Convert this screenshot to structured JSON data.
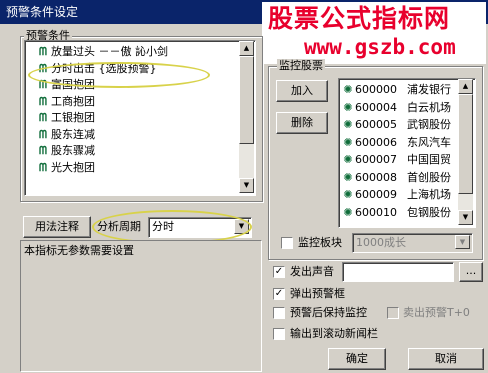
{
  "window": {
    "title": "预警条件设定"
  },
  "watermark": {
    "text_cn": "股票公式指标网",
    "url": "www.gszb.com"
  },
  "conditions": {
    "group_label": "预警条件",
    "items": [
      {
        "icon": "formula-icon",
        "label": "放量过头 －－傲 訫小剑"
      },
      {
        "icon": "formula-icon",
        "label": "分时出击 {选股预警}"
      },
      {
        "icon": "formula-icon",
        "label": "富国抱团"
      },
      {
        "icon": "formula-icon",
        "label": "工商抱团"
      },
      {
        "icon": "formula-icon",
        "label": "工银抱团"
      },
      {
        "icon": "formula-icon",
        "label": "股东连减"
      },
      {
        "icon": "formula-icon",
        "label": "股东骤减"
      },
      {
        "icon": "formula-icon",
        "label": "光大抱团"
      }
    ],
    "icon_glyph": "ᗰ"
  },
  "usage_button": "用法注释",
  "period": {
    "label": "分析周期",
    "value": "分时"
  },
  "description": "本指标无参数需要设置",
  "monitor": {
    "group_label": "监控股票",
    "add_button": "加入",
    "remove_button": "删除",
    "stocks": [
      {
        "code": "600000",
        "name": "浦发银行"
      },
      {
        "code": "600004",
        "name": "白云机场"
      },
      {
        "code": "600005",
        "name": "武钢股份"
      },
      {
        "code": "600006",
        "name": "东风汽车"
      },
      {
        "code": "600007",
        "name": "中国国贸"
      },
      {
        "code": "600008",
        "name": "首创股份"
      },
      {
        "code": "600009",
        "name": "上海机场"
      },
      {
        "code": "600010",
        "name": "包钢股份"
      }
    ],
    "dot_glyph": "✺",
    "sector_check_label": "监控板块",
    "sector_value": "1000成长"
  },
  "options": {
    "sound_label": "发出声音",
    "sound_checked": true,
    "sound_file": "",
    "browse_label": "...",
    "popup_label": "弹出预警框",
    "popup_checked": true,
    "keep_label": "预警后保持监控",
    "keep_checked": false,
    "sell_label": "卖出预警T+0",
    "sell_checked": false,
    "scroll_label": "输出到滚动新闻栏",
    "scroll_checked": false,
    "check_mark": "✓"
  },
  "ok_button": "确定",
  "cancel_button": "取消",
  "colors": {
    "titlebar": "#0a246a",
    "watermark": "#e8002d",
    "highlight_ellipse": "#d8d24a",
    "icon_green": "#0f6d3a"
  }
}
